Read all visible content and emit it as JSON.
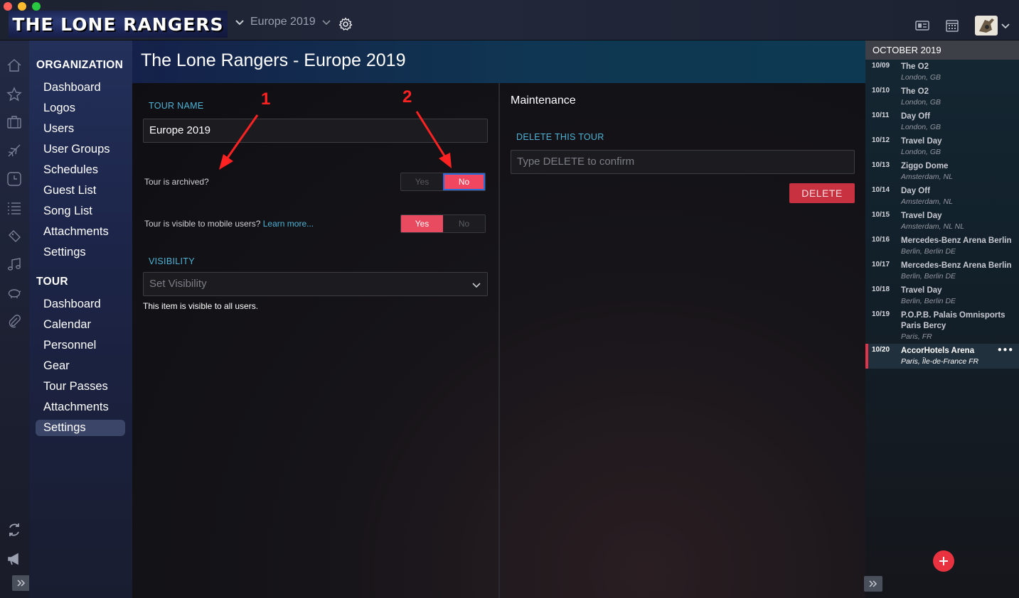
{
  "app": {
    "logo_text": "THE LONE RANGERS",
    "tour_selector": "Europe 2019"
  },
  "nav": {
    "organization_heading": "ORGANIZATION",
    "organization_items": [
      "Dashboard",
      "Logos",
      "Users",
      "User Groups",
      "Schedules",
      "Guest List",
      "Song List",
      "Attachments",
      "Settings"
    ],
    "tour_heading": "TOUR",
    "tour_items": [
      "Dashboard",
      "Calendar",
      "Personnel",
      "Gear",
      "Tour Passes",
      "Attachments",
      "Settings"
    ],
    "active_tour_item": "Settings"
  },
  "page": {
    "title": "The Lone Rangers - Europe 2019"
  },
  "settings": {
    "tour_name_label": "TOUR NAME",
    "tour_name_value": "Europe 2019",
    "archived_question": "Tour is archived?",
    "archived_yes": "Yes",
    "archived_no": "No",
    "archived_selected": "No",
    "mobile_question": "Tour is visible to mobile users?",
    "mobile_learn_more": "Learn more...",
    "mobile_yes": "Yes",
    "mobile_no": "No",
    "mobile_selected": "Yes",
    "visibility_label": "VISIBILITY",
    "visibility_placeholder": "Set Visibility",
    "visibility_help": "This item is visible to all users."
  },
  "annotations": {
    "arrow_1": "1",
    "arrow_2": "2"
  },
  "maintenance": {
    "title": "Maintenance",
    "delete_label": "DELETE THIS TOUR",
    "delete_placeholder": "Type DELETE to confirm",
    "delete_button": "DELETE"
  },
  "schedule": {
    "month": "OCTOBER 2019",
    "events": [
      {
        "date": "10/09",
        "name": "The O2",
        "location": "London, GB"
      },
      {
        "date": "10/10",
        "name": "The O2",
        "location": "London, GB"
      },
      {
        "date": "10/11",
        "name": "Day Off",
        "location": "London, GB"
      },
      {
        "date": "10/12",
        "name": "Travel Day",
        "location": "London, GB"
      },
      {
        "date": "10/13",
        "name": "Ziggo Dome",
        "location": "Amsterdam, NL"
      },
      {
        "date": "10/14",
        "name": "Day Off",
        "location": "Amsterdam, NL"
      },
      {
        "date": "10/15",
        "name": "Travel Day",
        "location": "Amsterdam, NL NL"
      },
      {
        "date": "10/16",
        "name": "Mercedes-Benz Arena Berlin",
        "location": "Berlin, Berlin DE"
      },
      {
        "date": "10/17",
        "name": "Mercedes-Benz Arena Berlin",
        "location": "Berlin, Berlin DE"
      },
      {
        "date": "10/18",
        "name": "Travel Day",
        "location": "Berlin, Berlin DE"
      },
      {
        "date": "10/19",
        "name": "P.O.P.B. Palais Omnisports Paris Bercy",
        "location": "Paris, FR"
      },
      {
        "date": "10/20",
        "name": "AccorHotels Arena",
        "location": "Paris, Île-de-France FR",
        "active": true,
        "more": "•••"
      }
    ]
  },
  "colors": {
    "accent_red": "#e84a5f",
    "link_blue": "#4fb3d6",
    "delete_red": "#c8313f"
  },
  "icons": {
    "rail": [
      "home-icon",
      "star-icon",
      "briefcase-icon",
      "plane-icon",
      "clock-icon",
      "list-icon",
      "ticket-icon",
      "music-icon",
      "piggy-bank-icon",
      "paperclip-icon",
      "sync-icon",
      "megaphone-icon"
    ],
    "top_right": [
      "id-card-icon",
      "calendar-icon",
      "avatar-guitar-icon"
    ]
  }
}
